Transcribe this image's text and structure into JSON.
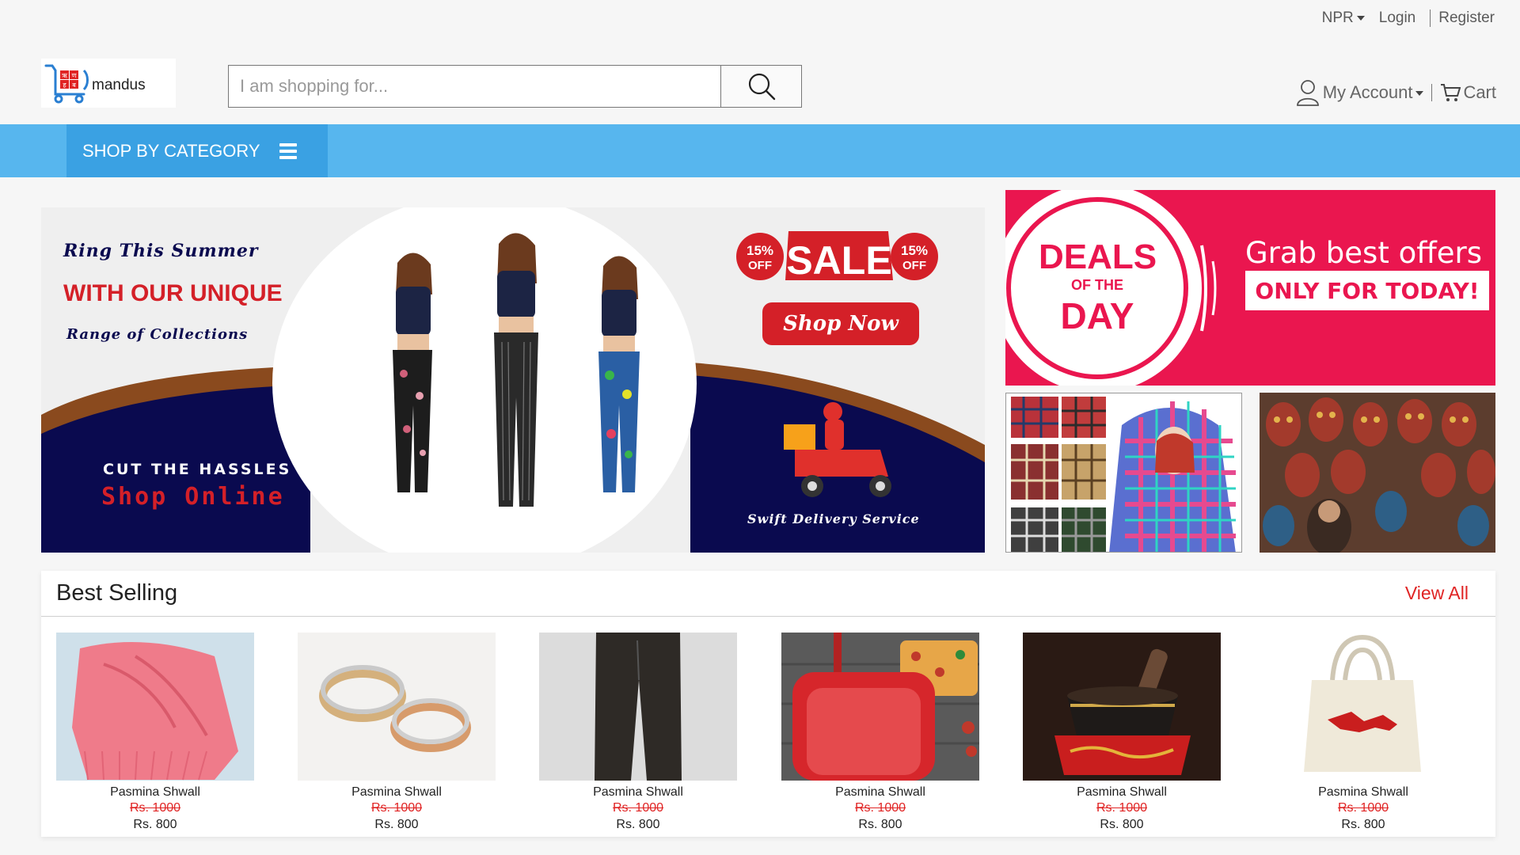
{
  "topbar": {
    "currency": "NPR",
    "login": "Login",
    "register": "Register"
  },
  "brand": {
    "name": "mandus",
    "badge_letters": [
      "ऋ",
      "ण",
      "ह",
      "ब"
    ]
  },
  "search": {
    "placeholder": "I am shopping for..."
  },
  "account": {
    "my_account": "My Account",
    "cart": "Cart"
  },
  "nav": {
    "shop_by_category": "SHOP BY CATEGORY"
  },
  "hero": {
    "line1": "Ring This Summer",
    "line2": "WITH OUR UNIQUE",
    "line3": "Range of Collections",
    "line4": "CUT THE HASSLES",
    "line5": "Shop Online",
    "sale": "SALE",
    "badge_pct": "15%",
    "badge_off": "OFF",
    "shop_now": "Shop Now",
    "delivery": "Swift Delivery Service"
  },
  "deals": {
    "deals": "DEALS",
    "of_the": "OF THE",
    "day": "DAY",
    "grab": "Grab best offers",
    "only": "ONLY FOR TODAY!"
  },
  "best_selling": {
    "title": "Best Selling",
    "view_all": "View All",
    "products": [
      {
        "name": "Pasmina Shwall",
        "old_price": "Rs. 1000",
        "price": "Rs. 800",
        "image": "pink-scarf"
      },
      {
        "name": "Pasmina Shwall",
        "old_price": "Rs. 1000",
        "price": "Rs. 800",
        "image": "rings"
      },
      {
        "name": "Pasmina Shwall",
        "old_price": "Rs. 1000",
        "price": "Rs. 800",
        "image": "trousers"
      },
      {
        "name": "Pasmina Shwall",
        "old_price": "Rs. 1000",
        "price": "Rs. 800",
        "image": "red-pan-pizza"
      },
      {
        "name": "Pasmina Shwall",
        "old_price": "Rs. 1000",
        "price": "Rs. 800",
        "image": "singing-bowl"
      },
      {
        "name": "Pasmina Shwall",
        "old_price": "Rs. 1000",
        "price": "Rs. 800",
        "image": "tote-bag"
      }
    ]
  },
  "colors": {
    "nav": "#57b6ee",
    "nav_button": "#3aa1e3",
    "accent_red": "#e02424",
    "deals_bg": "#ea164f",
    "hero_navy": "#0a0a4f"
  }
}
